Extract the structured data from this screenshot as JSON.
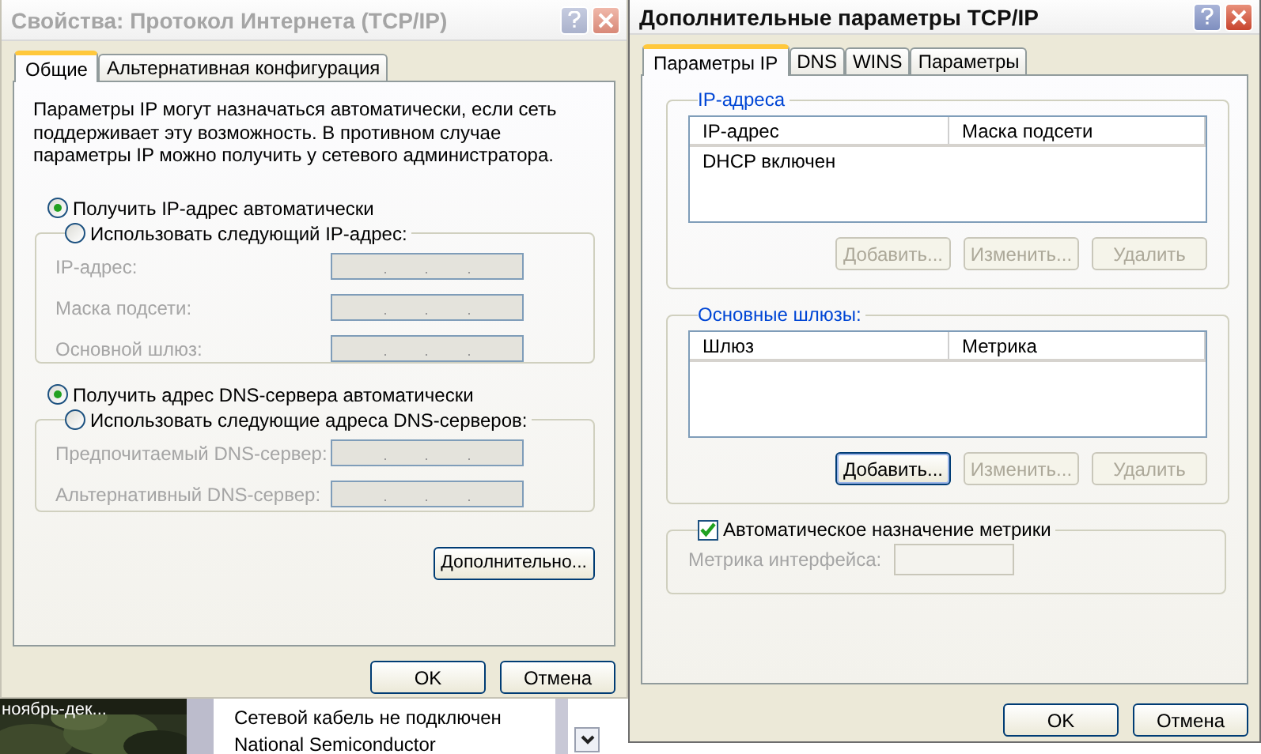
{
  "background_window": {
    "thumbnail": {
      "kind": "picture",
      "caption": "ноябрь-дек..."
    },
    "list_items": [
      "Сетевой кабель не подключен",
      "National Semiconductor"
    ]
  },
  "properties_dialog": {
    "title": "Свойства: Протокол Интернета (TCP/IP)",
    "active": false,
    "tabs": [
      {
        "label": "Общие",
        "selected": true
      },
      {
        "label": "Альтернативная конфигурация",
        "selected": false
      }
    ],
    "description": "Параметры IP могут назначаться автоматически, если сеть поддерживает эту возможность. В противном случае параметры IP можно получить у сетевого администратора.",
    "ip_auto": {
      "label": "Получить IP-адрес автоматически",
      "selected": true
    },
    "ip_manual": {
      "label": "Использовать следующий IP-адрес:",
      "selected": false
    },
    "ip_fields": [
      {
        "label": "IP-адрес:",
        "disabled": true
      },
      {
        "label": "Маска подсети:",
        "disabled": true
      },
      {
        "label": "Основной шлюз:",
        "disabled": true
      }
    ],
    "dns_auto": {
      "label": "Получить адрес DNS-сервера автоматически",
      "selected": true
    },
    "dns_manual": {
      "label": "Использовать следующие адреса DNS-серверов:",
      "selected": false
    },
    "dns_fields": [
      {
        "label": "Предпочитаемый DNS-сервер:",
        "disabled": true
      },
      {
        "label": "Альтернативный DNS-сервер:",
        "disabled": true
      }
    ],
    "advanced_button": "Дополнительно...",
    "buttons": [
      "OK",
      "Отмена"
    ]
  },
  "advanced_dialog": {
    "title": "Дополнительные параметры TCP/IP",
    "active": true,
    "tabs": [
      {
        "label": "Параметры IP",
        "selected": true
      },
      {
        "label": "DNS",
        "selected": false
      },
      {
        "label": "WINS",
        "selected": false
      },
      {
        "label": "Параметры",
        "selected": false
      }
    ],
    "ip_addresses": {
      "title": "IP-адреса",
      "columns": [
        "IP-адрес",
        "Маска подсети"
      ],
      "rows": [
        [
          "DHCP включен"
        ]
      ],
      "buttons": [
        {
          "label": "Добавить...",
          "disabled": true
        },
        {
          "label": "Изменить...",
          "disabled": true
        },
        {
          "label": "Удалить",
          "disabled": true
        }
      ]
    },
    "gateways": {
      "title": "Основные шлюзы:",
      "columns": [
        "Шлюз",
        "Метрика"
      ],
      "buttons": [
        {
          "label": "Добавить...",
          "disabled": false
        },
        {
          "label": "Изменить...",
          "disabled": true
        },
        {
          "label": "Удалить",
          "disabled": true
        }
      ]
    },
    "auto_metric": {
      "label": "Автоматическое назначение метрики",
      "checked": true
    },
    "metric_field": {
      "label": "Метрика интерфейса:",
      "disabled": true
    },
    "buttons": [
      "OK",
      "Отмена"
    ]
  }
}
